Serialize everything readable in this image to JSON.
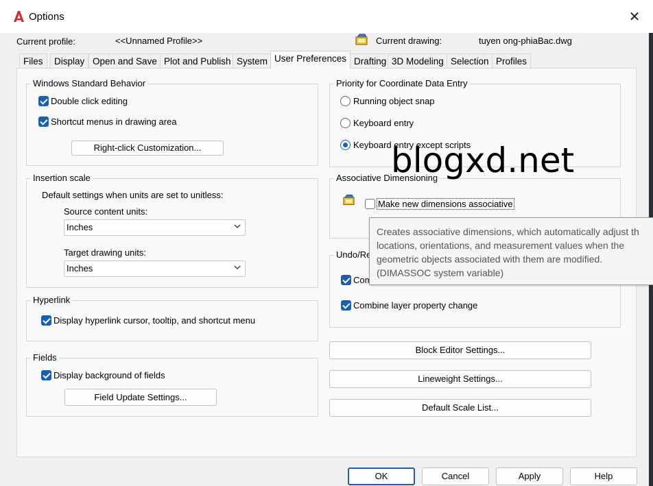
{
  "window": {
    "title": "Options",
    "close_glyph": "✕"
  },
  "header": {
    "current_profile_label": "Current profile:",
    "current_profile_value": "<<Unnamed Profile>>",
    "current_drawing_label": "Current drawing:",
    "current_drawing_value": "tuyen ong-phiaBac.dwg"
  },
  "tabs": [
    "Files",
    "Display",
    "Open and Save",
    "Plot and Publish",
    "System",
    "User Preferences",
    "Drafting",
    "3D Modeling",
    "Selection",
    "Profiles"
  ],
  "active_tab": "User Preferences",
  "windows_standard": {
    "title": "Windows Standard Behavior",
    "double_click": "Double click editing",
    "double_click_checked": true,
    "shortcut_menus": "Shortcut menus in drawing area",
    "shortcut_menus_checked": true,
    "right_click_button": "Right-click Customization..."
  },
  "insertion_scale": {
    "title": "Insertion scale",
    "description": "Default settings when units are set to unitless:",
    "source_label": "Source content units:",
    "source_value": "Inches",
    "target_label": "Target drawing units:",
    "target_value": "Inches"
  },
  "hyperlink": {
    "title": "Hyperlink",
    "display": "Display hyperlink cursor, tooltip, and shortcut menu",
    "display_checked": true
  },
  "fields": {
    "title": "Fields",
    "display_bg": "Display background of fields",
    "display_bg_checked": true,
    "update_button": "Field Update Settings..."
  },
  "priority": {
    "title": "Priority for Coordinate Data Entry",
    "options": [
      "Running object snap",
      "Keyboard entry",
      "Keyboard entry except scripts"
    ],
    "selected_index": 2
  },
  "associative": {
    "title": "Associative Dimensioning",
    "make_new": "Make new dimensions associative",
    "make_new_checked": false
  },
  "undo_redo": {
    "title": "Undo/Re",
    "combine_zoom": "Com",
    "combine_zoom_checked": true,
    "combine_layer": "Combine layer property change",
    "combine_layer_checked": true
  },
  "tooltip": {
    "lines": [
      "Creates associative dimensions, which automatically adjust th",
      "locations, orientations, and measurement values when the",
      "geometric objects associated with them are modified.",
      "(DIMASSOC system variable)"
    ]
  },
  "side_buttons": {
    "block_editor": "Block Editor Settings...",
    "lineweight": "Lineweight Settings...",
    "default_scale": "Default Scale List..."
  },
  "footer": {
    "ok": "OK",
    "cancel": "Cancel",
    "apply": "Apply",
    "help": "Help"
  },
  "watermark": "blogxd.net",
  "colors": {
    "accent": "#1a5fb4",
    "autocad_red": "#d8262c"
  }
}
